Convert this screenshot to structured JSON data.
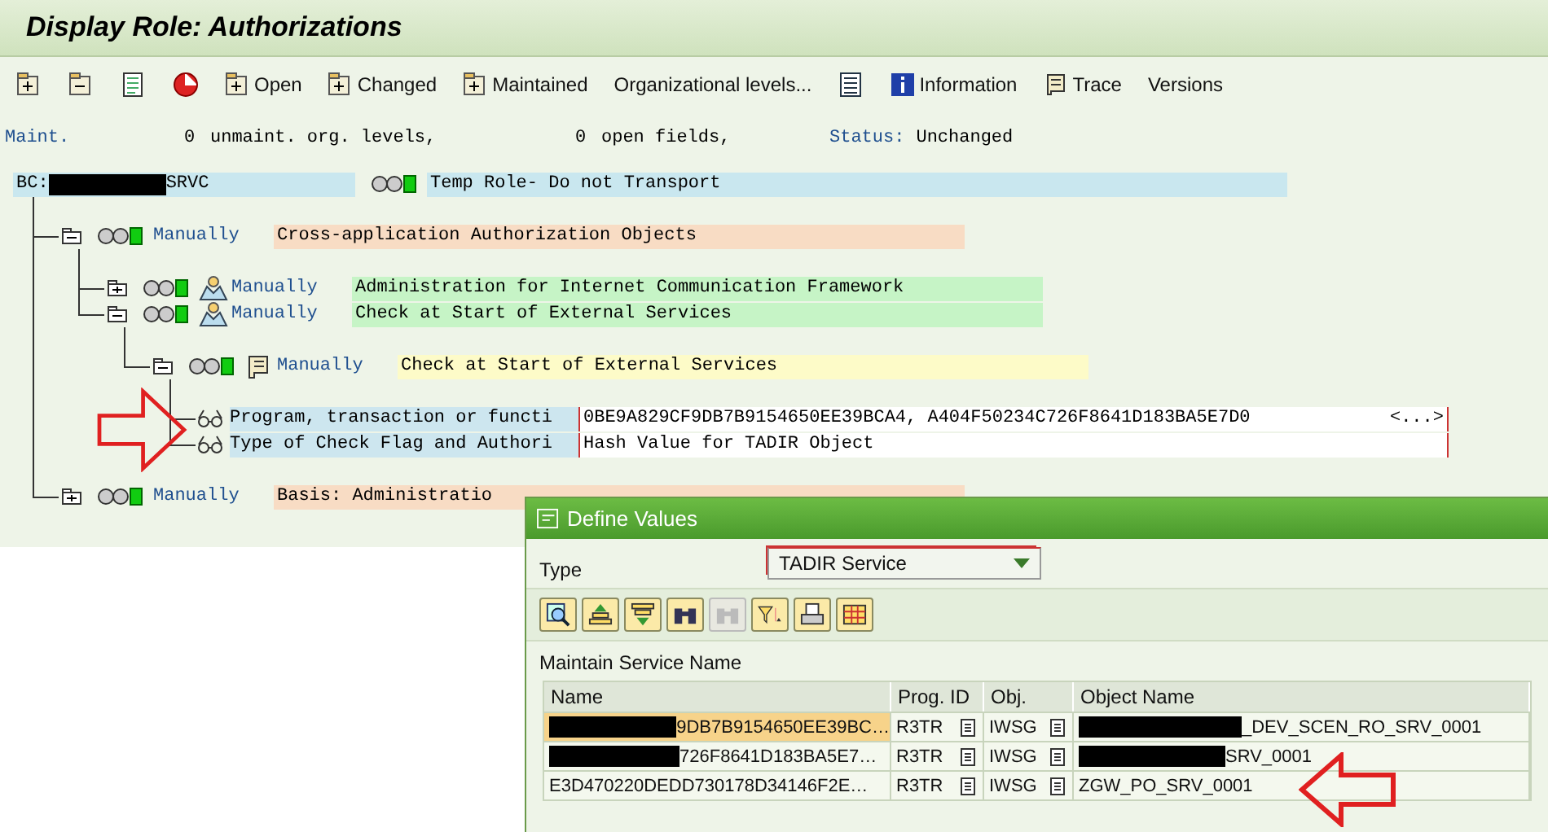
{
  "title": "Display Role: Authorizations",
  "toolbar": [
    {
      "kind": "expand-all"
    },
    {
      "kind": "collapse-all"
    },
    {
      "kind": "table"
    },
    {
      "kind": "stop"
    },
    {
      "kind": "expand",
      "label": "Open"
    },
    {
      "kind": "expand",
      "label": "Changed"
    },
    {
      "kind": "expand",
      "label": "Maintained"
    },
    {
      "kind": "text",
      "label": "Organizational levels..."
    },
    {
      "kind": "list"
    },
    {
      "kind": "info",
      "label": "Information"
    },
    {
      "kind": "trace",
      "label": "Trace"
    },
    {
      "kind": "text",
      "label": "Versions"
    }
  ],
  "status_line": {
    "maint": "Maint.",
    "unmaint_count": "0",
    "unmaint_label": "unmaint. org. levels,",
    "open_count": "0",
    "open_label": "open fields,",
    "status_label": "Status:",
    "status_value": "Unchanged"
  },
  "tree": {
    "kind": "role",
    "prefix": "BC:",
    "redacted": true,
    "suffix": "SRVC",
    "text": "Temp Role- Do not Transport",
    "children": [
      {
        "kind": "class",
        "expanded": true,
        "status": "Manually",
        "text": "Cross-application Authorization Objects",
        "children": [
          {
            "kind": "object",
            "expanded": false,
            "status": "Manually",
            "text": "Administration for Internet Communication Framework"
          },
          {
            "kind": "object",
            "expanded": true,
            "status": "Manually",
            "text": "Check at Start of External Services",
            "children": [
              {
                "kind": "authorization",
                "expanded": true,
                "status": "Manually",
                "text": "Check at Start of External Services",
                "children": [
                  {
                    "kind": "field",
                    "name": "Program, transaction or functi",
                    "value": "0BE9A829CF9DB7B9154650EE39BCA4, A404F50234C726F8641D183BA5E7D0",
                    "more": "<...>"
                  },
                  {
                    "kind": "field",
                    "name": "Type of Check Flag and Authori",
                    "value": "Hash Value for TADIR Object"
                  }
                ]
              }
            ]
          }
        ]
      },
      {
        "kind": "class",
        "expanded": false,
        "status": "Manually",
        "text": "Basis: Administratio"
      }
    ]
  },
  "dialog": {
    "title": "Define Values",
    "type_label": "Type",
    "type_value": "TADIR Service",
    "tools": [
      {
        "kind": "details",
        "disabled": false
      },
      {
        "kind": "sort-up",
        "disabled": false
      },
      {
        "kind": "sort-down",
        "disabled": false
      },
      {
        "kind": "find",
        "disabled": false
      },
      {
        "kind": "find-next",
        "disabled": true
      },
      {
        "kind": "filter",
        "disabled": false
      },
      {
        "kind": "print",
        "disabled": false
      },
      {
        "kind": "grid",
        "disabled": false
      }
    ],
    "section": "Maintain Service Name",
    "columns": [
      "Name",
      "Prog. ID",
      "Obj.",
      "Object Name"
    ],
    "rows": [
      {
        "selected": true,
        "name_redacted": true,
        "name": "9DB7B9154650EE39BC…",
        "prog_id": "R3TR",
        "obj": "IWSG",
        "object_redacted": true,
        "object_name": "_DEV_SCEN_RO_SRV_0001"
      },
      {
        "selected": false,
        "name_redacted": true,
        "name": "726F8641D183BA5E7…",
        "prog_id": "R3TR",
        "obj": "IWSG",
        "object_redacted": true,
        "object_name": "SRV_0001"
      },
      {
        "selected": false,
        "name_redacted": false,
        "name": "E3D470220DEDD730178D34146F2E…",
        "prog_id": "R3TR",
        "obj": "IWSG",
        "object_redacted": false,
        "object_name": "ZGW_PO_SRV_0001"
      }
    ]
  }
}
